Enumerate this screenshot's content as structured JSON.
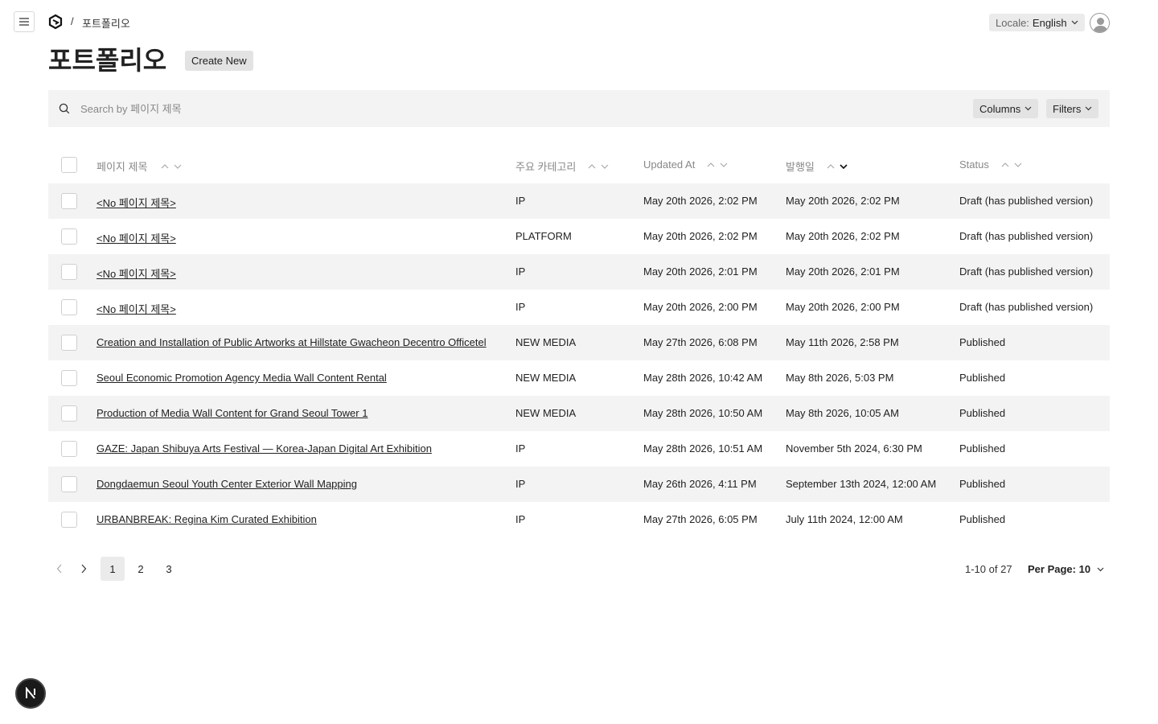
{
  "header": {
    "breadcrumb_separator": "/",
    "breadcrumb": "포트폴리오",
    "locale_label": "Locale:",
    "locale_value": "English"
  },
  "page": {
    "title": "포트폴리오",
    "create_label": "Create New"
  },
  "search": {
    "placeholder": "Search by 페이지 제목",
    "columns_label": "Columns",
    "filters_label": "Filters"
  },
  "table": {
    "columns": [
      "페이지 제목",
      "주요 카테고리",
      "Updated At",
      "발행일",
      "Status"
    ],
    "active_sort": {
      "column": "발행일",
      "direction": "descending"
    },
    "rows": [
      {
        "title": "<No 페이지 제목>",
        "category": "IP",
        "updated": "May 20th 2026, 2:02 PM",
        "published": "May 20th 2026, 2:02 PM",
        "status": "Draft (has published version)"
      },
      {
        "title": "<No 페이지 제목>",
        "category": "PLATFORM",
        "updated": "May 20th 2026, 2:02 PM",
        "published": "May 20th 2026, 2:02 PM",
        "status": "Draft (has published version)"
      },
      {
        "title": "<No 페이지 제목>",
        "category": "IP",
        "updated": "May 20th 2026, 2:01 PM",
        "published": "May 20th 2026, 2:01 PM",
        "status": "Draft (has published version)"
      },
      {
        "title": "<No 페이지 제목>",
        "category": "IP",
        "updated": "May 20th 2026, 2:00 PM",
        "published": "May 20th 2026, 2:00 PM",
        "status": "Draft (has published version)"
      },
      {
        "title": "Creation and Installation of Public Artworks at Hillstate Gwacheon Decentro Officetel",
        "category": "NEW MEDIA",
        "updated": "May 27th 2026, 6:08 PM",
        "published": "May 11th 2026, 2:58 PM",
        "status": "Published"
      },
      {
        "title": "Seoul Economic Promotion Agency Media Wall Content Rental",
        "category": "NEW MEDIA",
        "updated": "May 28th 2026, 10:42 AM",
        "published": "May 8th 2026, 5:03 PM",
        "status": "Published"
      },
      {
        "title": "Production of Media Wall Content for Grand Seoul Tower 1",
        "category": "NEW MEDIA",
        "updated": "May 28th 2026, 10:50 AM",
        "published": "May 8th 2026, 10:05 AM",
        "status": "Published"
      },
      {
        "title": "GAZE: Japan Shibuya Arts Festival — Korea-Japan Digital Art Exhibition",
        "category": "IP",
        "updated": "May 28th 2026, 10:51 AM",
        "published": "November 5th 2024, 6:30 PM",
        "status": "Published"
      },
      {
        "title": "Dongdaemun Seoul Youth Center Exterior Wall Mapping",
        "category": "IP",
        "updated": "May 26th 2026, 4:11 PM",
        "published": "September 13th 2024, 12:00 AM",
        "status": "Published"
      },
      {
        "title": "URBANBREAK: Regina Kim Curated Exhibition",
        "category": "IP",
        "updated": "May 27th 2026, 6:05 PM",
        "published": "July 11th 2024, 12:00 AM",
        "status": "Published"
      }
    ]
  },
  "pagination": {
    "pages": [
      "1",
      "2",
      "3"
    ],
    "current_page": "1",
    "count_text": "1-10 of 27",
    "per_page_text": "Per Page: 10"
  },
  "dev_badge": {
    "letter": "N"
  }
}
